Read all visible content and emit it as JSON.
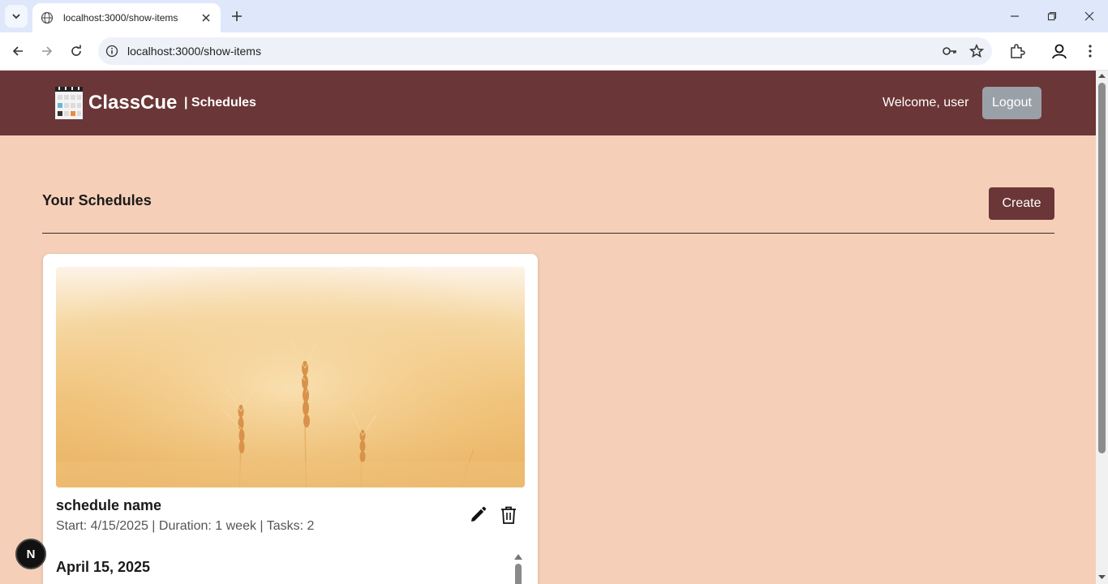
{
  "browser": {
    "tab_title": "localhost:3000/show-items",
    "url": "localhost:3000/show-items"
  },
  "header": {
    "brand": "ClassCue",
    "subtitle": "| Schedules",
    "welcome": "Welcome, user",
    "logout_label": "Logout"
  },
  "main": {
    "title": "Your Schedules",
    "create_label": "Create"
  },
  "schedule_card": {
    "name": "schedule name",
    "meta": "Start: 4/15/2025 | Duration: 1 week | Tasks: 2",
    "date_heading": "April 15, 2025"
  },
  "dev_badge": "N",
  "colors": {
    "header_bg": "#6b3637",
    "page_bg": "#f5cfb8",
    "logout_bg": "#9aa0a8",
    "create_bg": "#6b3637"
  }
}
